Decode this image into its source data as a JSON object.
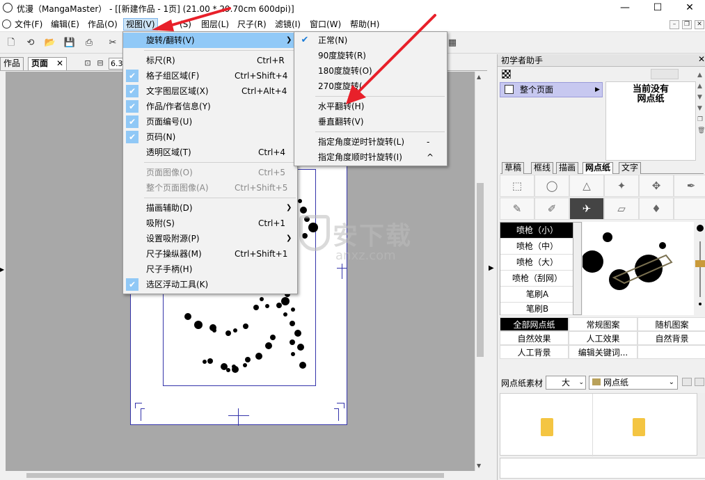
{
  "window": {
    "title": "优漫（MangaMaster） - [[新建作品 - 1页] (21.00 * 29.70cm 600dpi)]",
    "controls": {
      "minimize": "—",
      "maximize": "☐",
      "close": "✕"
    }
  },
  "menubar": {
    "items": [
      "文件(F)",
      "编辑(E)",
      "作品(O)",
      "视图(V)",
      "(S)",
      "图层(L)",
      "尺子(R)",
      "滤镜(I)",
      "窗口(W)",
      "帮助(H)"
    ],
    "mdi_controls": [
      "–",
      "❐",
      "✕"
    ]
  },
  "toolbar": {
    "buttons": [
      "new-page",
      "open-folder",
      "save",
      "print",
      "copy",
      "cut"
    ]
  },
  "doc_tabs": {
    "tabs": [
      {
        "label": "作品"
      },
      {
        "label": "页面",
        "close": "✕"
      }
    ],
    "zoom": "6.3"
  },
  "view_menu": {
    "items": [
      {
        "label": "旋转/翻转(V)",
        "shortcut": "",
        "submenu": true,
        "highlighted": true
      },
      {
        "label": "标尺(R)",
        "shortcut": "Ctrl+R"
      },
      {
        "label": "格子组区域(F)",
        "shortcut": "Ctrl+Shift+4",
        "checked": true
      },
      {
        "label": "文字图层区域(X)",
        "shortcut": "Ctrl+Alt+4",
        "checked": true
      },
      {
        "label": "作品/作者信息(Y)",
        "shortcut": "",
        "checked": true
      },
      {
        "label": "页面编号(U)",
        "shortcut": "",
        "checked": true
      },
      {
        "label": "页码(N)",
        "shortcut": "",
        "checked": true
      },
      {
        "label": "透明区域(T)",
        "shortcut": "Ctrl+4"
      },
      {
        "label": "页面图像(O)",
        "shortcut": "Ctrl+5",
        "disabled": true
      },
      {
        "label": "整个页面图像(A)",
        "shortcut": "Ctrl+Shift+5",
        "disabled": true
      },
      {
        "label": "描画辅助(D)",
        "shortcut": "",
        "submenu": true
      },
      {
        "label": "吸附(S)",
        "shortcut": "Ctrl+1"
      },
      {
        "label": "设置吸附源(P)",
        "shortcut": "",
        "submenu": true
      },
      {
        "label": "尺子操纵器(M)",
        "shortcut": "Ctrl+Shift+1"
      },
      {
        "label": "尺子手柄(H)",
        "shortcut": ""
      },
      {
        "label": "选区浮动工具(K)",
        "shortcut": "",
        "checked": true
      }
    ]
  },
  "rotate_submenu": {
    "items": [
      {
        "label": "正常(N)",
        "checked": true,
        "shortcut": ""
      },
      {
        "label": "90度旋转(R)",
        "shortcut": ""
      },
      {
        "label": "180度旋转(O)",
        "shortcut": ""
      },
      {
        "label": "270度旋转(",
        "shortcut": ""
      },
      {
        "label": "水平翻转(H)",
        "shortcut": ""
      },
      {
        "label": "垂直翻转(V)",
        "shortcut": ""
      },
      {
        "label": "指定角度逆时针旋转(L)",
        "shortcut": "-"
      },
      {
        "label": "指定角度顺时针旋转(I)",
        "shortcut": "^"
      }
    ]
  },
  "assistant": {
    "title": "初学者助手",
    "close": "✕",
    "page_select": "整个页面",
    "no_tone_text": [
      "当前没有",
      "网点纸"
    ],
    "tabs": [
      "草稿",
      "框线",
      "描画",
      "网点纸",
      "文字"
    ],
    "active_tab": "网点纸",
    "brushes": [
      "喷枪（小）",
      "喷枪（中）",
      "喷枪（大）",
      "喷枪（刮网）",
      "笔刷A",
      "笔刷B"
    ],
    "tone_categories": [
      [
        "全部网点纸",
        "常规图案",
        "随机图案"
      ],
      [
        "自然效果",
        "人工效果",
        "自然背景"
      ],
      [
        "人工背景",
        "编辑关键词...",
        ""
      ]
    ],
    "material_label": "网点纸素材",
    "material_size": "大",
    "material_type": "网点纸"
  },
  "watermark": {
    "main": "安下载",
    "sub": "anxz.com"
  },
  "colors": {
    "highlight": "#91c9f7",
    "annotation_arrow": "#e8202a",
    "page_border": "#3333aa"
  }
}
